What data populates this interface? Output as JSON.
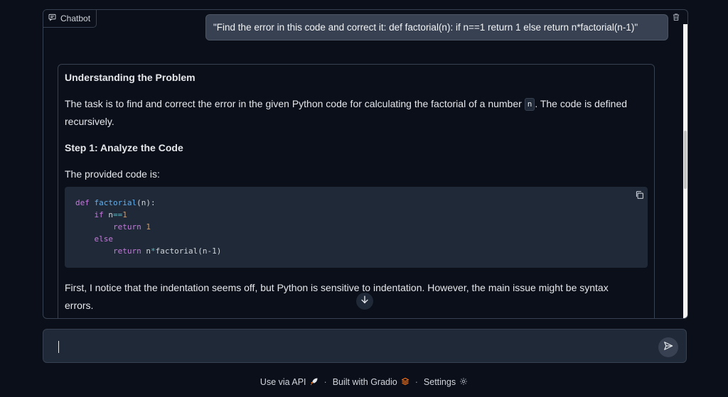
{
  "chatbot": {
    "label": "Chatbot",
    "user_message": "\"Find the error in this code and correct it: def factorial(n): if n==1 return 1 else return n*factorial(n-1)\"",
    "bot": {
      "heading1": "Understanding the Problem",
      "para1_part1": "The task is to find and correct the error in the given Python code for calculating the factorial of a number ",
      "para1_code": "n",
      "para1_part2": ". The code is defined",
      "para1_line2": "recursively.",
      "heading2": "Step 1: Analyze the Code",
      "para2": "The provided code is:",
      "code": {
        "l1_kw": "def",
        "l1_fn": "factorial",
        "l1_rest": "(n):",
        "l2_kw": "if",
        "l2_rest": " n",
        "l2_op": "==",
        "l2_num": "1",
        "l3_kw": "return",
        "l3_num": "1",
        "l4_kw": "else",
        "l5_kw": "return",
        "l5_a": " n",
        "l5_op": "*",
        "l5_b": "factorial(n-1)"
      },
      "para3_line1": "First, I notice that the indentation seems off, but Python is sensitive to indentation. However, the main issue might be syntax",
      "para3_line2": "errors."
    }
  },
  "input": {
    "value": "",
    "placeholder": ""
  },
  "footer": {
    "api": "Use via API",
    "gradio": "Built with Gradio",
    "settings": "Settings",
    "separator": "·"
  },
  "icons": {
    "chat": "chat-bubble-icon",
    "trash": "trash-icon",
    "copy": "copy-icon",
    "scroll_down": "arrow-down-icon",
    "send": "send-icon",
    "api": "rocket-icon",
    "gradio": "gradio-logo-icon",
    "settings": "gear-icon"
  },
  "colors": {
    "background": "#0b0f19",
    "panel_border": "#374151",
    "user_bubble": "#374151",
    "code_bg": "#1f2937",
    "accent_orange": "#f97316"
  }
}
